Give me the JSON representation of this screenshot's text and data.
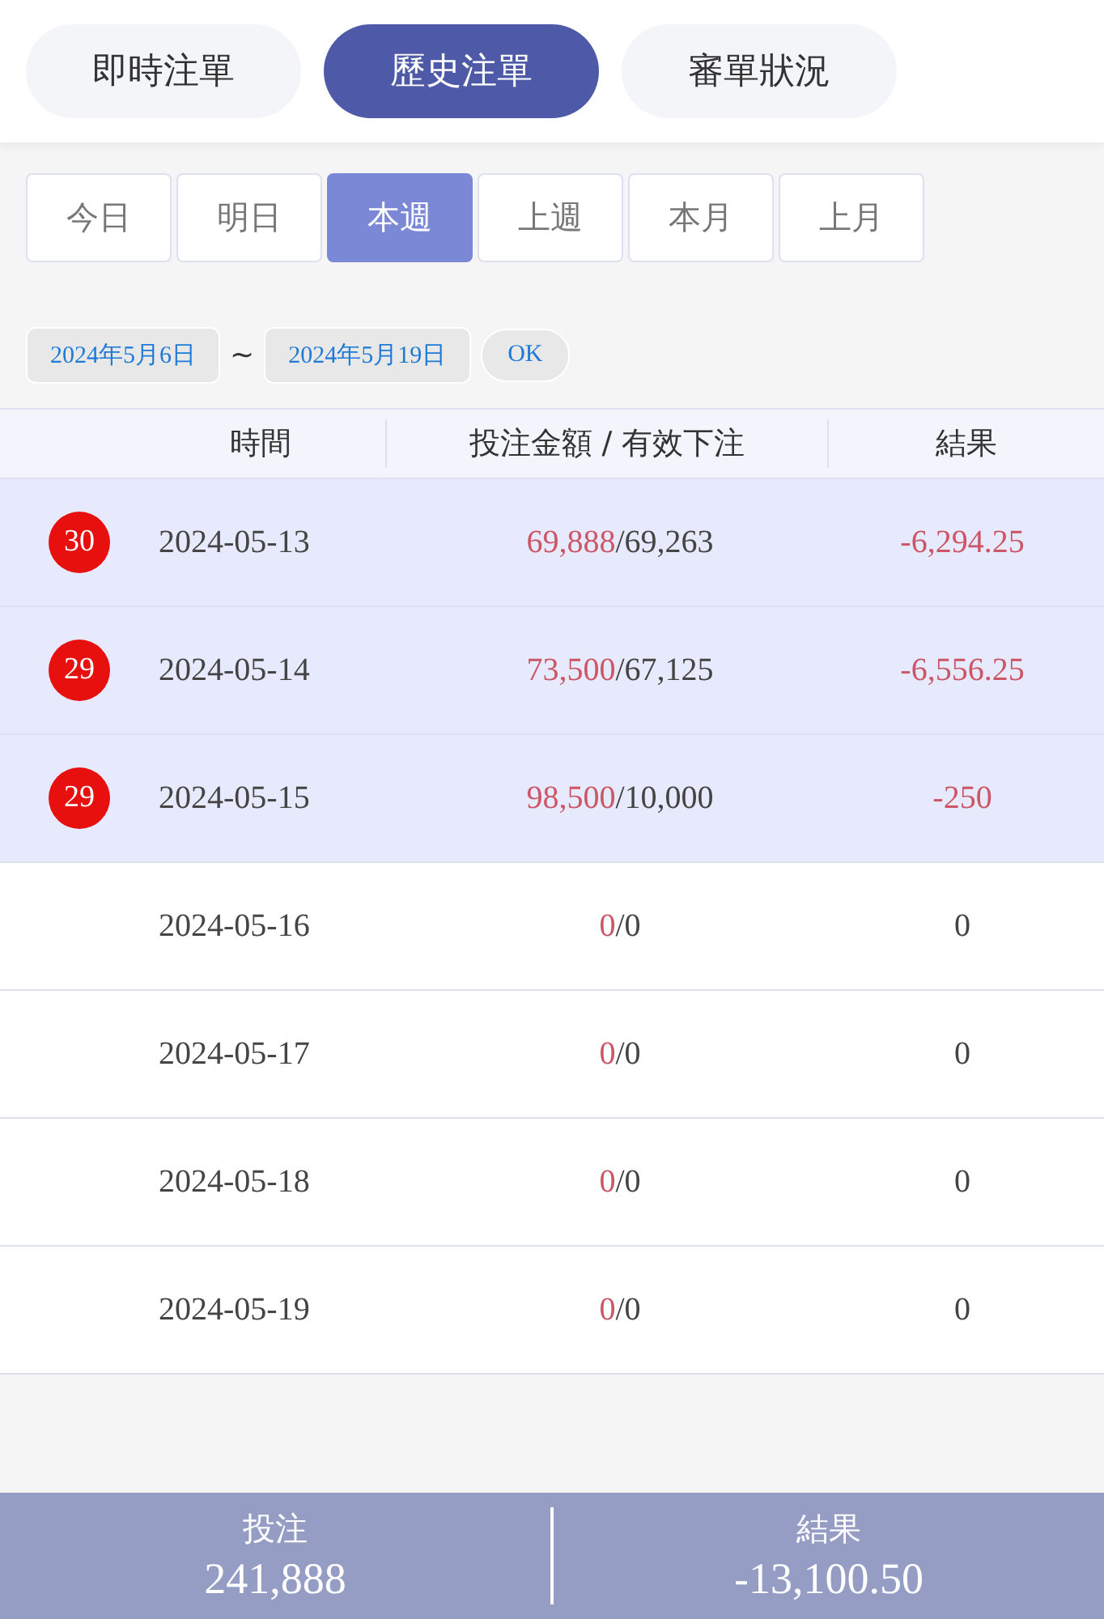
{
  "tabs": [
    {
      "label": "即時注單",
      "selected": false
    },
    {
      "label": "歷史注單",
      "selected": true
    },
    {
      "label": "審單狀況",
      "selected": false
    }
  ],
  "periods": [
    {
      "label": "今日",
      "selected": false
    },
    {
      "label": "明日",
      "selected": false
    },
    {
      "label": "本週",
      "selected": true
    },
    {
      "label": "上週",
      "selected": false
    },
    {
      "label": "本月",
      "selected": false
    },
    {
      "label": "上月",
      "selected": false
    }
  ],
  "date_range": {
    "start": "2024年5月6日",
    "separator": "~",
    "end": "2024年5月19日",
    "ok": "OK"
  },
  "table": {
    "columns": [
      "時間",
      "投注金額 / 有效下注",
      "結果"
    ],
    "rows": [
      {
        "badge": "30",
        "date": "2024-05-13",
        "bet": "69,888",
        "valid": "/69,263",
        "result": "-6,294.25",
        "negative": true
      },
      {
        "badge": "29",
        "date": "2024-05-14",
        "bet": "73,500",
        "valid": "/67,125",
        "result": "-6,556.25",
        "negative": true
      },
      {
        "badge": "29",
        "date": "2024-05-15",
        "bet": "98,500",
        "valid": "/10,000",
        "result": "-250",
        "negative": true
      },
      {
        "date": "2024-05-16",
        "bet": "0",
        "valid": "/0",
        "result": "0",
        "negative": false
      },
      {
        "date": "2024-05-17",
        "bet": "0",
        "valid": "/0",
        "result": "0",
        "negative": false
      },
      {
        "date": "2024-05-18",
        "bet": "0",
        "valid": "/0",
        "result": "0",
        "negative": false
      },
      {
        "date": "2024-05-19",
        "bet": "0",
        "valid": "/0",
        "result": "0",
        "negative": false
      }
    ]
  },
  "summary": [
    {
      "label": "投注",
      "value": "241,888"
    },
    {
      "label": "結果",
      "value": "-13,100.50"
    }
  ]
}
